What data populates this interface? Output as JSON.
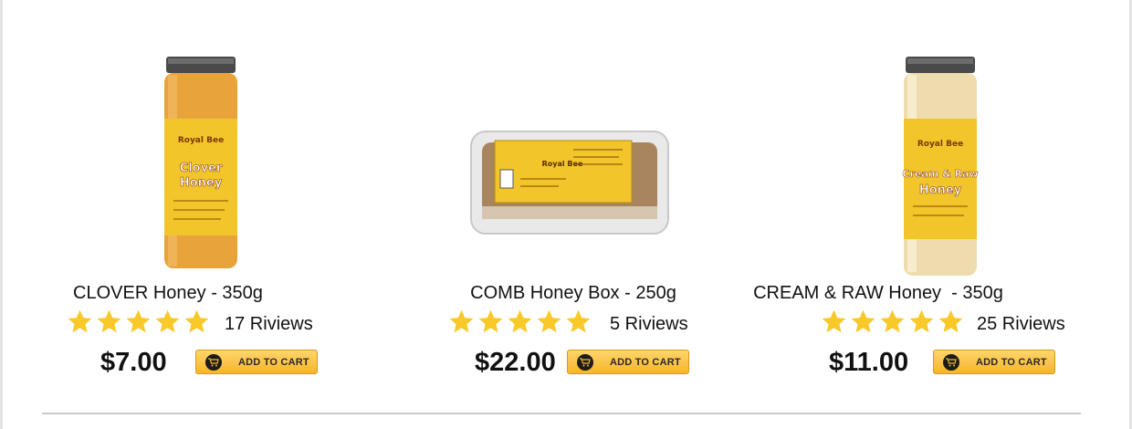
{
  "products": [
    {
      "title": "CLOVER Honey - 350g",
      "rating": 5,
      "reviews": "17 Riviews",
      "price": "$7.00",
      "cart_label": "ADD TO CART",
      "image": {
        "kind": "jar",
        "brand": "Royal Bee",
        "label_lines": [
          "Clover",
          "Honey"
        ],
        "fill": "#e8a43a"
      }
    },
    {
      "title": "COMB Honey Box - 250g",
      "rating": 5,
      "reviews": "5 Riviews",
      "price": "$22.00",
      "cart_label": "ADD TO CART",
      "image": {
        "kind": "box",
        "brand": "Royal Bee"
      }
    },
    {
      "title": "CREAM & RAW Honey  - 350g",
      "rating": 5,
      "reviews": "25 Riviews",
      "price": "$11.00",
      "cart_label": "ADD TO CART",
      "image": {
        "kind": "jar",
        "brand": "Royal Bee",
        "label_lines": [
          "Cream & Raw",
          "Honey"
        ],
        "fill": "#efdcae"
      }
    }
  ],
  "colors": {
    "star": "#f8c928",
    "button_top": "#ffd56a",
    "button_bottom": "#f6b52d",
    "label_yellow": "#f2c52b"
  }
}
